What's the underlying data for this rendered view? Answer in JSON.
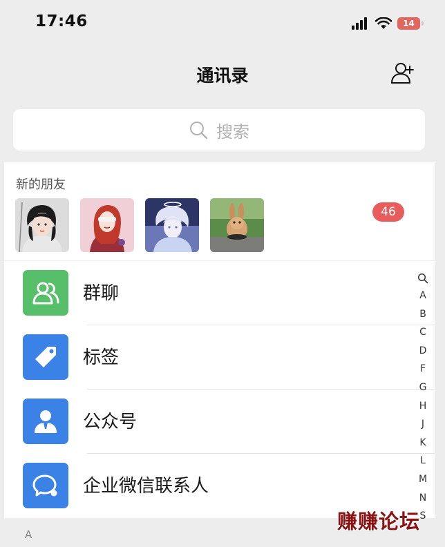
{
  "status_bar": {
    "time": "17:46",
    "battery": "14",
    "battery_color": "#e2655f"
  },
  "nav": {
    "title": "通讯录",
    "add_icon": "add-contact-icon"
  },
  "search": {
    "placeholder": "搜索",
    "icon": "search-icon"
  },
  "new_friends": {
    "label": "新的朋友",
    "badge": "46",
    "badge_color": "#e85c5b",
    "avatars": [
      "avatar-girl-illustration",
      "avatar-girl-red-hair",
      "avatar-anime-boy",
      "avatar-rabbit-photo"
    ]
  },
  "menu": [
    {
      "label": "群聊",
      "icon": "group-chat-icon",
      "color": "#57be6a"
    },
    {
      "label": "标签",
      "icon": "tag-icon",
      "color": "#3b82e6"
    },
    {
      "label": "公众号",
      "icon": "official-account-icon",
      "color": "#3b82e6"
    },
    {
      "label": "企业微信联系人",
      "icon": "wecom-contacts-icon",
      "color": "#3b82e6"
    }
  ],
  "index_bar": [
    "A",
    "B",
    "C",
    "D",
    "F",
    "G",
    "H",
    "J",
    "K",
    "L",
    "M",
    "N"
  ],
  "index_bar_partial": "S",
  "section_header": "A",
  "watermark": "赚赚论坛"
}
